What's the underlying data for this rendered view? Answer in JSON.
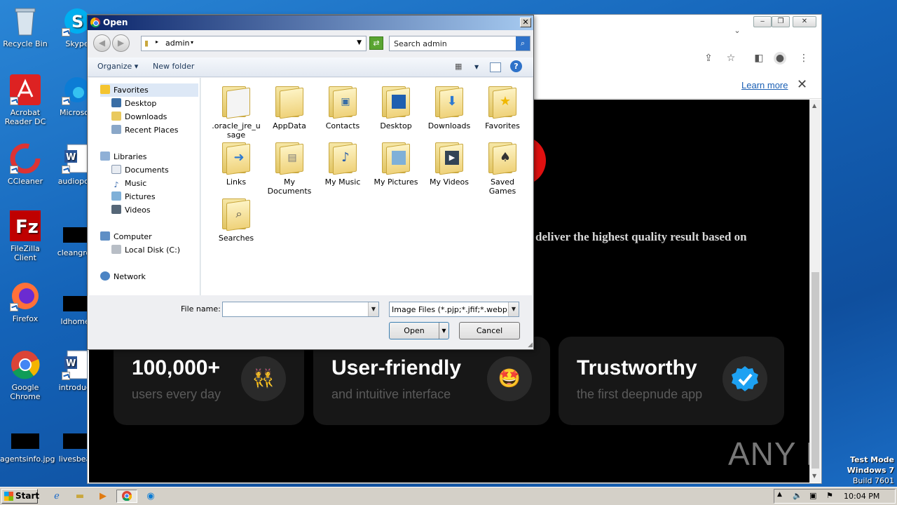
{
  "desktop": {
    "icons": [
      {
        "label": "Recycle Bin",
        "icon": "recycle-bin-icon"
      },
      {
        "label": "Acrobat Reader DC",
        "icon": "acrobat-icon"
      },
      {
        "label": "CCleaner",
        "icon": "ccleaner-icon"
      },
      {
        "label": "FileZilla Client",
        "icon": "filezilla-icon"
      },
      {
        "label": "Firefox",
        "icon": "firefox-icon"
      },
      {
        "label": "Google Chrome",
        "icon": "chrome-icon"
      },
      {
        "label": "agentsinfo.jpg",
        "icon": "image-file-icon"
      },
      {
        "label": "Skype",
        "icon": "skype-icon"
      },
      {
        "label": "Microsoft",
        "icon": "edge-icon"
      },
      {
        "label": "audiopolit",
        "icon": "word-doc-icon"
      },
      {
        "label": "cleangrow",
        "icon": "image-file-icon"
      },
      {
        "label": "ldhomes",
        "icon": "image-file-icon"
      },
      {
        "label": "introducti",
        "icon": "word-doc-icon"
      },
      {
        "label": "livesbead",
        "icon": "image-file-icon"
      }
    ]
  },
  "browser": {
    "infobar": {
      "learn_more": "Learn more"
    },
    "page": {
      "hero_text": "deliver the highest quality result based on",
      "cards": [
        {
          "title": "100,000+",
          "subtitle": "users every day",
          "badge_icon": "users-icon"
        },
        {
          "title": "User-friendly",
          "subtitle": "and intuitive interface",
          "badge_icon": "smiley-icon"
        },
        {
          "title": "Trustworthy",
          "subtitle": "the first deepnude app",
          "badge_icon": "verified-icon"
        }
      ],
      "watermark": "ANY RUN"
    }
  },
  "dialog": {
    "title": "Open",
    "address": {
      "path": "admin"
    },
    "search": {
      "placeholder": "Search admin"
    },
    "toolbar": {
      "organize": "Organize",
      "new_folder": "New folder"
    },
    "nav": {
      "favorites": "Favorites",
      "favorites_items": [
        "Desktop",
        "Downloads",
        "Recent Places"
      ],
      "libraries": "Libraries",
      "libraries_items": [
        "Documents",
        "Music",
        "Pictures",
        "Videos"
      ],
      "computer": "Computer",
      "computer_items": [
        "Local Disk (C:)"
      ],
      "network": "Network"
    },
    "files": [
      {
        "name": ".oracle_jre_usage",
        "line1": ".oracle_jre_u",
        "line2": "sage",
        "icon": "folder-icon"
      },
      {
        "name": "AppData",
        "line1": "AppData",
        "line2": "",
        "icon": "folder-icon"
      },
      {
        "name": "Contacts",
        "line1": "Contacts",
        "line2": "",
        "icon": "contacts-folder-icon"
      },
      {
        "name": "Desktop",
        "line1": "Desktop",
        "line2": "",
        "icon": "desktop-folder-icon"
      },
      {
        "name": "Downloads",
        "line1": "Downloads",
        "line2": "",
        "icon": "downloads-folder-icon"
      },
      {
        "name": "Favorites",
        "line1": "Favorites",
        "line2": "",
        "icon": "favorites-folder-icon"
      },
      {
        "name": "Links",
        "line1": "Links",
        "line2": "",
        "icon": "links-folder-icon"
      },
      {
        "name": "My Documents",
        "line1": "My",
        "line2": "Documents",
        "icon": "documents-folder-icon"
      },
      {
        "name": "My Music",
        "line1": "My Music",
        "line2": "",
        "icon": "music-folder-icon"
      },
      {
        "name": "My Pictures",
        "line1": "My Pictures",
        "line2": "",
        "icon": "pictures-folder-icon"
      },
      {
        "name": "My Videos",
        "line1": "My Videos",
        "line2": "",
        "icon": "videos-folder-icon"
      },
      {
        "name": "Saved Games",
        "line1": "Saved",
        "line2": "Games",
        "icon": "games-folder-icon"
      },
      {
        "name": "Searches",
        "line1": "Searches",
        "line2": "",
        "icon": "searches-folder-icon"
      }
    ],
    "file_name_label": "File name:",
    "file_name_value": "",
    "filter": "Image Files (*.pjp;*.jfif;*.webp;*",
    "open_button": "Open",
    "cancel_button": "Cancel"
  },
  "taskbar": {
    "start": "Start",
    "clock": "10:04 PM",
    "test_mode": [
      "Test Mode",
      "Windows 7",
      "Build 7601"
    ]
  },
  "colors": {
    "dialog_title_start": "#0a246a",
    "dialog_title_end": "#a6caf0",
    "link": "#1a5fb4",
    "page_background": "#000000",
    "card_background": "#171717",
    "verified_badge": "#1da1f2"
  }
}
